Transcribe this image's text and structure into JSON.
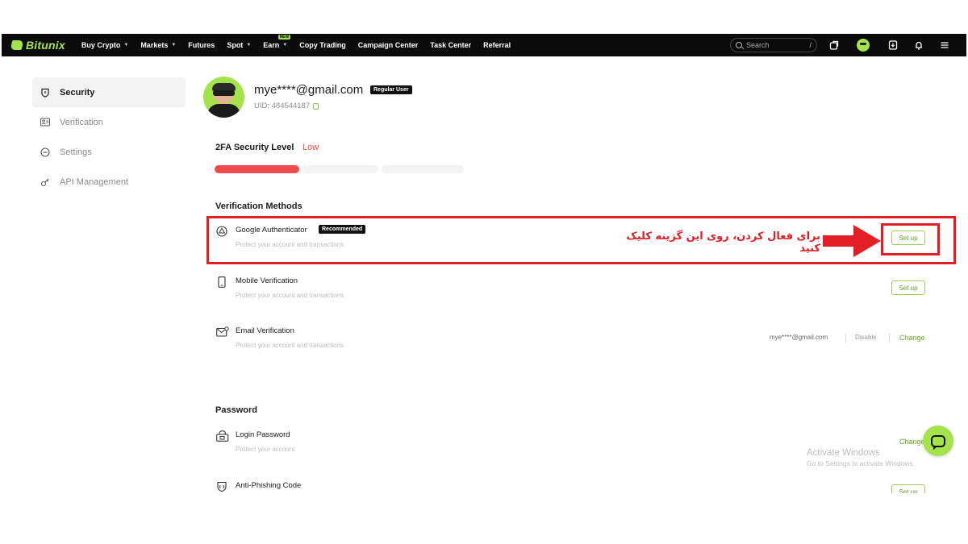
{
  "nav": {
    "brand": "Bitunix",
    "items": [
      {
        "label": "Buy Crypto",
        "dropdown": true
      },
      {
        "label": "Markets",
        "dropdown": true
      },
      {
        "label": "Futures",
        "dropdown": false
      },
      {
        "label": "Spot",
        "dropdown": true
      },
      {
        "label": "Earn",
        "dropdown": true,
        "badge": "NEW"
      },
      {
        "label": "Copy Trading",
        "dropdown": false
      },
      {
        "label": "Campaign Center",
        "dropdown": false
      },
      {
        "label": "Task Center",
        "dropdown": false
      },
      {
        "label": "Referral",
        "dropdown": false
      }
    ],
    "search_placeholder": "Search",
    "search_shortcut": "/",
    "icons": [
      "assets-icon",
      "avatar",
      "download-icon",
      "bell-icon",
      "menu-icon"
    ]
  },
  "sidebar": {
    "items": [
      {
        "label": "Security",
        "icon": "shield-icon",
        "active": true
      },
      {
        "label": "Verification",
        "icon": "id-card-icon",
        "active": false
      },
      {
        "label": "Settings",
        "icon": "settings-icon",
        "active": false
      },
      {
        "label": "API Management",
        "icon": "api-key-icon",
        "active": false
      }
    ]
  },
  "profile": {
    "email": "mye****@gmail.com",
    "user_type": "Regular User",
    "uid_label": "UID:",
    "uid": "484544187"
  },
  "security": {
    "label": "2FA Security Level",
    "level": "Low",
    "level_color": "#ef4a4a",
    "level_filled_segments": 1,
    "level_total_segments": 3
  },
  "verification": {
    "title": "Verification Methods",
    "methods": [
      {
        "title": "Google Authenticator",
        "badge": "Recommended",
        "desc": "Protect your account and transactions",
        "action": "Set up",
        "icon": "google-authenticator-icon"
      },
      {
        "title": "Mobile Verification",
        "desc": "Protect your account and transactions",
        "action": "Set up",
        "icon": "mobile-icon"
      },
      {
        "title": "Email Verification",
        "desc": "Protect your account and transactions",
        "email": "mye****@gmail.com",
        "disable": "Disable",
        "change": "Change",
        "icon": "email-icon"
      }
    ]
  },
  "password": {
    "title": "Password",
    "items": [
      {
        "title": "Login Password",
        "desc": "Protect your account",
        "action": "Change",
        "icon": "lock-icon"
      },
      {
        "title": "Anti-Phishing Code",
        "desc": "",
        "action": "Set up",
        "icon": "anti-phishing-icon"
      }
    ]
  },
  "annotation": {
    "text": "برای فعال کردن، روی این گزینه کلیک کنید",
    "color": "#e31e24"
  },
  "watermark": {
    "line1": "Activate Windows",
    "line2": "Go to Settings to activate Windows"
  },
  "colors": {
    "accent": "#a4e34a",
    "accent_text": "#6aab22",
    "nav_bg": "#0b0b0b",
    "danger": "#e31e24"
  }
}
